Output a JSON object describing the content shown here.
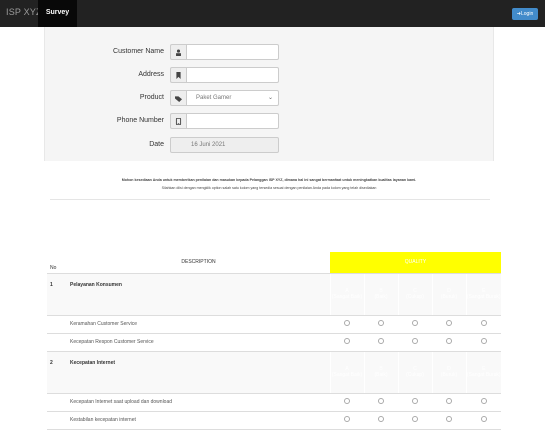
{
  "navbar": {
    "brand": "ISP XYZ",
    "tab": "Survey",
    "login": "Login"
  },
  "form": {
    "customer_name": {
      "label": "Customer Name",
      "value": ""
    },
    "address": {
      "label": "Address",
      "value": ""
    },
    "product": {
      "label": "Product",
      "value": "Paket Gamer"
    },
    "phone": {
      "label": "Phone Number",
      "value": ""
    },
    "date": {
      "label": "Date",
      "value": "16 Juni 2021"
    }
  },
  "notice": {
    "line1": "Mohon kesediaan Anda untuk memberikan penilaian dan masukan kepada Pelanggan ISP XYZ, dimana hal ini sangat bermanfaat untuk meningkatkan kualitas layanan kami.",
    "line2": "Silahkan diisi dengan mengklik option salah satu kolom yang tersedia sesuai dengan penilaian Anda pada kolom yang telah disediakan"
  },
  "table": {
    "no_header": "No",
    "desc_header": "DESCRIPTION",
    "quality_header": "QUALITY",
    "grades": [
      {
        "letter": "A",
        "text": "(Sangat Baik)"
      },
      {
        "letter": "B",
        "text": "(Baik)"
      },
      {
        "letter": "C",
        "text": "(Cukup)"
      },
      {
        "letter": "D",
        "text": "(Buruk)"
      },
      {
        "letter": "E",
        "text": "(Sangat Buruk)"
      }
    ],
    "categories": [
      {
        "no": "1",
        "name": "Pelayanan Konsumen",
        "items": [
          "Keramahan Customer Service",
          "Kecepatan Respon Customer Service"
        ]
      },
      {
        "no": "2",
        "name": "Kecepatan Internet",
        "items": [
          "Kecepatan Internet saat upload dan download",
          "Kestabilan kecepatan internet"
        ]
      }
    ]
  },
  "colors": {
    "navbar": "#222222",
    "quality_header": "#ffff00",
    "login": "#428bca"
  }
}
